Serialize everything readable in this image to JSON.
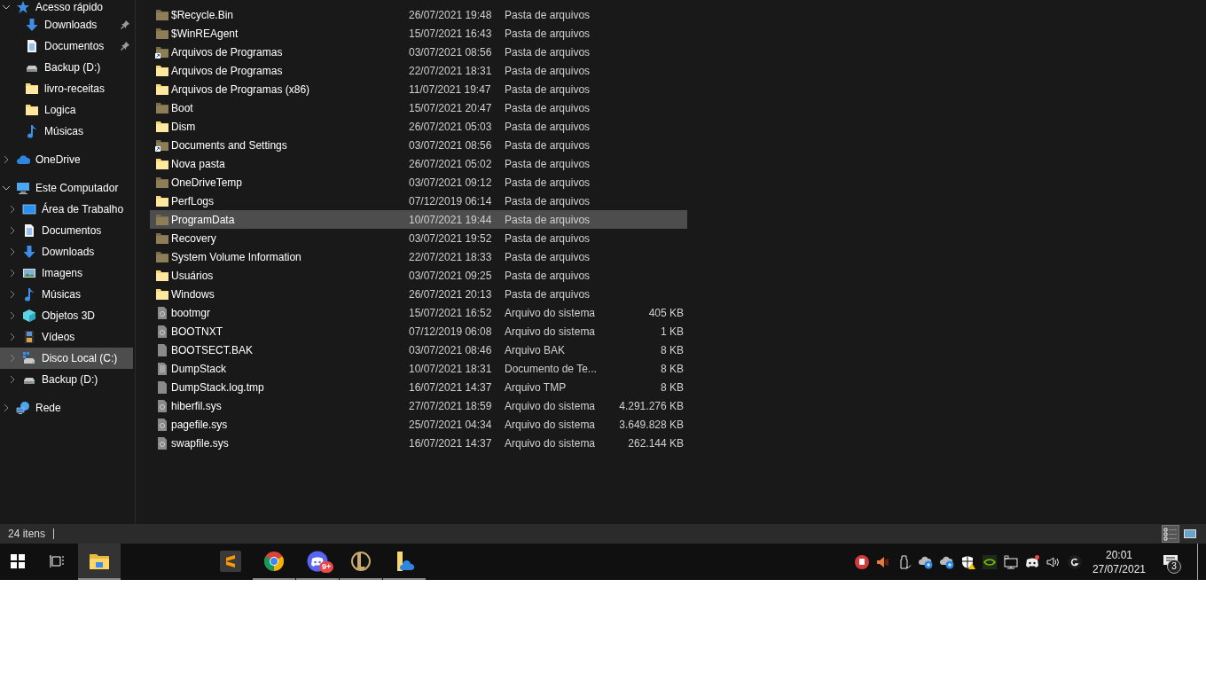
{
  "sidebar": {
    "items": [
      {
        "label": "Acesso rápido",
        "kind": "star",
        "expanded": true,
        "selected": false,
        "children": [
          {
            "label": "Downloads",
            "kind": "download",
            "pinned": true,
            "selected": false
          },
          {
            "label": "Documentos",
            "kind": "document",
            "pinned": true,
            "selected": false
          },
          {
            "label": "Backup (D:)",
            "kind": "drive",
            "pinned": false,
            "selected": false
          },
          {
            "label": "livro-receitas",
            "kind": "folder",
            "pinned": false,
            "selected": false
          },
          {
            "label": "Logica",
            "kind": "folder",
            "pinned": false,
            "selected": false
          },
          {
            "label": "Músicas",
            "kind": "music",
            "pinned": false,
            "selected": false
          }
        ]
      },
      {
        "label": "OneDrive",
        "kind": "cloud",
        "expanded": false,
        "selected": false
      },
      {
        "label": "Este Computador",
        "kind": "computer",
        "expanded": true,
        "selected": false,
        "children": [
          {
            "label": "Área de Trabalho",
            "kind": "desktop",
            "expanded": false,
            "selected": false
          },
          {
            "label": "Documentos",
            "kind": "document",
            "expanded": false,
            "selected": false
          },
          {
            "label": "Downloads",
            "kind": "download",
            "expanded": false,
            "selected": false
          },
          {
            "label": "Imagens",
            "kind": "pictures",
            "expanded": false,
            "selected": false
          },
          {
            "label": "Músicas",
            "kind": "music",
            "expanded": false,
            "selected": false
          },
          {
            "label": "Objetos 3D",
            "kind": "cube",
            "expanded": false,
            "selected": false
          },
          {
            "label": "Vídeos",
            "kind": "video",
            "expanded": false,
            "selected": false
          },
          {
            "label": "Disco Local (C:)",
            "kind": "drive-windows",
            "expanded": false,
            "selected": true
          },
          {
            "label": "Backup (D:)",
            "kind": "drive",
            "expanded": false,
            "selected": false
          }
        ]
      },
      {
        "label": "Rede",
        "kind": "network",
        "expanded": false,
        "selected": false
      }
    ]
  },
  "files": {
    "rows": [
      {
        "kind": "folder-system",
        "name": "$Recycle.Bin",
        "date": "26/07/2021 19:48",
        "type": "Pasta de arquivos",
        "selected": false
      },
      {
        "kind": "folder-system",
        "name": "$WinREAgent",
        "date": "15/07/2021 16:43",
        "type": "Pasta de arquivos",
        "selected": false
      },
      {
        "kind": "folder-link",
        "name": "Arquivos de Programas",
        "date": "03/07/2021 08:56",
        "type": "Pasta de arquivos",
        "selected": false
      },
      {
        "kind": "folder",
        "name": "Arquivos de Programas",
        "date": "22/07/2021 18:31",
        "type": "Pasta de arquivos",
        "selected": false
      },
      {
        "kind": "folder",
        "name": "Arquivos de Programas (x86)",
        "date": "11/07/2021 19:47",
        "type": "Pasta de arquivos",
        "selected": false
      },
      {
        "kind": "folder-system",
        "name": "Boot",
        "date": "15/07/2021 20:47",
        "type": "Pasta de arquivos",
        "selected": false
      },
      {
        "kind": "folder",
        "name": "Dism",
        "date": "26/07/2021 05:03",
        "type": "Pasta de arquivos",
        "selected": false
      },
      {
        "kind": "folder-link",
        "name": "Documents and Settings",
        "date": "03/07/2021 08:56",
        "type": "Pasta de arquivos",
        "selected": false
      },
      {
        "kind": "folder",
        "name": "Nova pasta",
        "date": "26/07/2021 05:02",
        "type": "Pasta de arquivos",
        "selected": false
      },
      {
        "kind": "folder-system",
        "name": "OneDriveTemp",
        "date": "03/07/2021 09:12",
        "type": "Pasta de arquivos",
        "selected": false
      },
      {
        "kind": "folder",
        "name": "PerfLogs",
        "date": "07/12/2019 06:14",
        "type": "Pasta de arquivos",
        "selected": false
      },
      {
        "kind": "folder-system",
        "name": "ProgramData",
        "date": "10/07/2021 19:44",
        "type": "Pasta de arquivos",
        "selected": true
      },
      {
        "kind": "folder-system",
        "name": "Recovery",
        "date": "03/07/2021 19:52",
        "type": "Pasta de arquivos",
        "selected": false
      },
      {
        "kind": "folder-system",
        "name": "System Volume Information",
        "date": "22/07/2021 18:33",
        "type": "Pasta de arquivos",
        "selected": false
      },
      {
        "kind": "folder",
        "name": "Usuários",
        "date": "03/07/2021 09:25",
        "type": "Pasta de arquivos",
        "selected": false
      },
      {
        "kind": "folder",
        "name": "Windows",
        "date": "26/07/2021 20:13",
        "type": "Pasta de arquivos",
        "selected": false
      },
      {
        "kind": "file-system",
        "name": "bootmgr",
        "date": "15/07/2021 16:52",
        "type": "Arquivo do sistema",
        "size": "405 KB",
        "selected": false
      },
      {
        "kind": "file-system",
        "name": "BOOTNXT",
        "date": "07/12/2019 06:08",
        "type": "Arquivo do sistema",
        "size": "1 KB",
        "selected": false
      },
      {
        "kind": "file",
        "name": "BOOTSECT.BAK",
        "date": "03/07/2021 08:46",
        "type": "Arquivo BAK",
        "size": "8 KB",
        "selected": false
      },
      {
        "kind": "file-text",
        "name": "DumpStack",
        "date": "10/07/2021 18:31",
        "type": "Documento de Te...",
        "size": "8 KB",
        "selected": false
      },
      {
        "kind": "file",
        "name": "DumpStack.log.tmp",
        "date": "16/07/2021 14:37",
        "type": "Arquivo TMP",
        "size": "8 KB",
        "selected": false
      },
      {
        "kind": "file-system",
        "name": "hiberfil.sys",
        "date": "27/07/2021 18:59",
        "type": "Arquivo do sistema",
        "size": "4.291.276 KB",
        "selected": false
      },
      {
        "kind": "file-system",
        "name": "pagefile.sys",
        "date": "25/07/2021 04:34",
        "type": "Arquivo do sistema",
        "size": "3.649.828 KB",
        "selected": false
      },
      {
        "kind": "file-system",
        "name": "swapfile.sys",
        "date": "16/07/2021 14:37",
        "type": "Arquivo do sistema",
        "size": "262.144 KB",
        "selected": false
      }
    ]
  },
  "status_bar": {
    "count": "24 itens",
    "view_buttons": [
      {
        "kind": "details",
        "selected": true
      },
      {
        "kind": "thumbnails",
        "selected": false
      }
    ]
  },
  "taskbar": {
    "apps": [
      {
        "kind": "explorer",
        "running": true,
        "active": true
      },
      {
        "kind": "sublime",
        "running": false,
        "active": false
      },
      {
        "kind": "chrome",
        "running": true,
        "active": false
      },
      {
        "kind": "discord",
        "running": true,
        "active": false,
        "badge": "9+"
      },
      {
        "kind": "league",
        "running": true,
        "active": false
      },
      {
        "kind": "onedrive-folder",
        "running": true,
        "active": false
      }
    ],
    "tray": [
      {
        "kind": "antivirus"
      },
      {
        "kind": "speaker"
      },
      {
        "kind": "usb"
      },
      {
        "kind": "cloud-sync"
      },
      {
        "kind": "cloud-sync"
      },
      {
        "kind": "shield-warning"
      },
      {
        "kind": "nvidia"
      },
      {
        "kind": "network"
      },
      {
        "kind": "discord"
      },
      {
        "kind": "volume"
      },
      {
        "kind": "logitech"
      }
    ],
    "time": "20:01",
    "date": "27/07/2021",
    "notifications": "3"
  }
}
